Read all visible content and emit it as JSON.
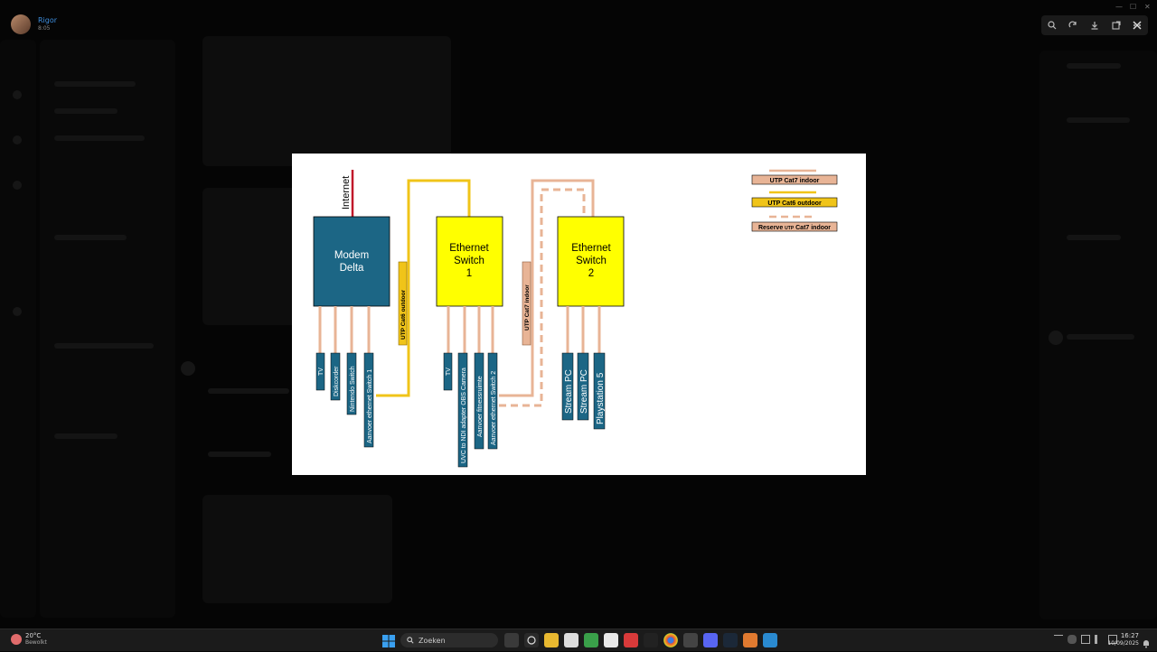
{
  "viewer": {
    "user_name": "Rigor",
    "time": "8:05",
    "toolbar_icons": [
      "zoom-icon",
      "rotate-icon",
      "download-icon",
      "open-external-icon",
      "more-icon"
    ],
    "close_icon": "close-icon"
  },
  "diagram": {
    "internet_label": "Internet",
    "modem": [
      "Modem",
      "Delta"
    ],
    "switch1": [
      "Ethernet",
      "Switch",
      "1"
    ],
    "switch2": [
      "Ethernet",
      "Switch",
      "2"
    ],
    "cable_outdoor": "UTP Cat6 outdoor",
    "cable_indoor": "UTP Cat7 indoor",
    "legend": {
      "cat7": "UTP Cat7 indoor",
      "cat6": "UTP Cat6 outdoor",
      "reserve_prefix": "Reserve",
      "reserve_mid": "UTP",
      "reserve_suffix": "Cat7 indoor"
    },
    "modem_ports": [
      "TV",
      "Diskcorder",
      "Nintendo Switch",
      "Aanvoer ethernet Switch 1"
    ],
    "switch1_ports": [
      "TV",
      "UVC to NDI adapter OBS Camera",
      "Aanvoer fitnessruimte",
      "Aanvoer ethernet Switch 2"
    ],
    "switch2_ports": [
      "Stream PC",
      "Stream PC",
      "Playstation 5"
    ],
    "colors": {
      "modem": "#1c6685",
      "switch": "#ffff00",
      "cat6": "#f0c419",
      "cat7": "#e8b496",
      "internet": "#c0182a",
      "port": "#1c6685"
    }
  },
  "taskbar": {
    "weather_temp": "20°C",
    "weather_desc": "Bewolkt",
    "search_placeholder": "Zoeken",
    "time": "16:27",
    "date": "10/09/2025"
  }
}
